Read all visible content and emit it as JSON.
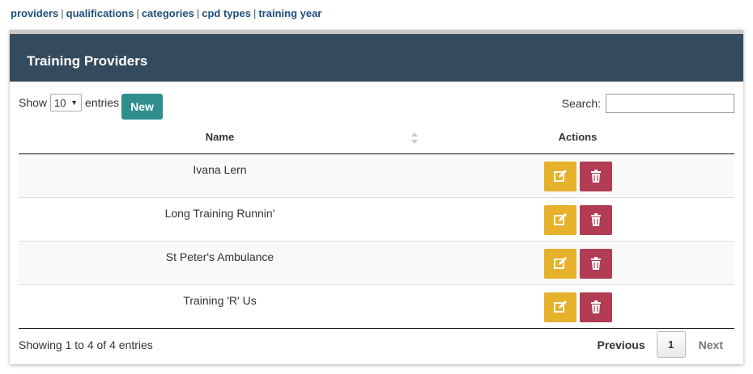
{
  "topnav": {
    "links": [
      "providers",
      "qualifications",
      "categories",
      "cpd types",
      "training year"
    ],
    "separator": "|"
  },
  "panel": {
    "title": "Training Providers"
  },
  "controls": {
    "show_label": "Show",
    "entries_value": "10",
    "entries_label": "entries",
    "new_button": "New",
    "search_label": "Search:",
    "search_value": ""
  },
  "table": {
    "headers": {
      "name": "Name",
      "actions": "Actions"
    },
    "rows": [
      {
        "name": "Ivana Lern"
      },
      {
        "name": "Long Training Runnin'"
      },
      {
        "name": "St Peter's Ambulance"
      },
      {
        "name": "Training 'R' Us"
      }
    ]
  },
  "footer": {
    "info": "Showing 1 to 4 of 4 entries",
    "previous": "Previous",
    "page": "1",
    "next": "Next"
  },
  "colors": {
    "header_bg": "#344b5e",
    "new_button": "#2f8f8f",
    "edit_button": "#e6b22c",
    "delete_button": "#b23c53",
    "link": "#1f4e79"
  },
  "icons": {
    "edit": "pencil-square-icon",
    "delete": "trash-icon",
    "sort": "sort-icon"
  }
}
